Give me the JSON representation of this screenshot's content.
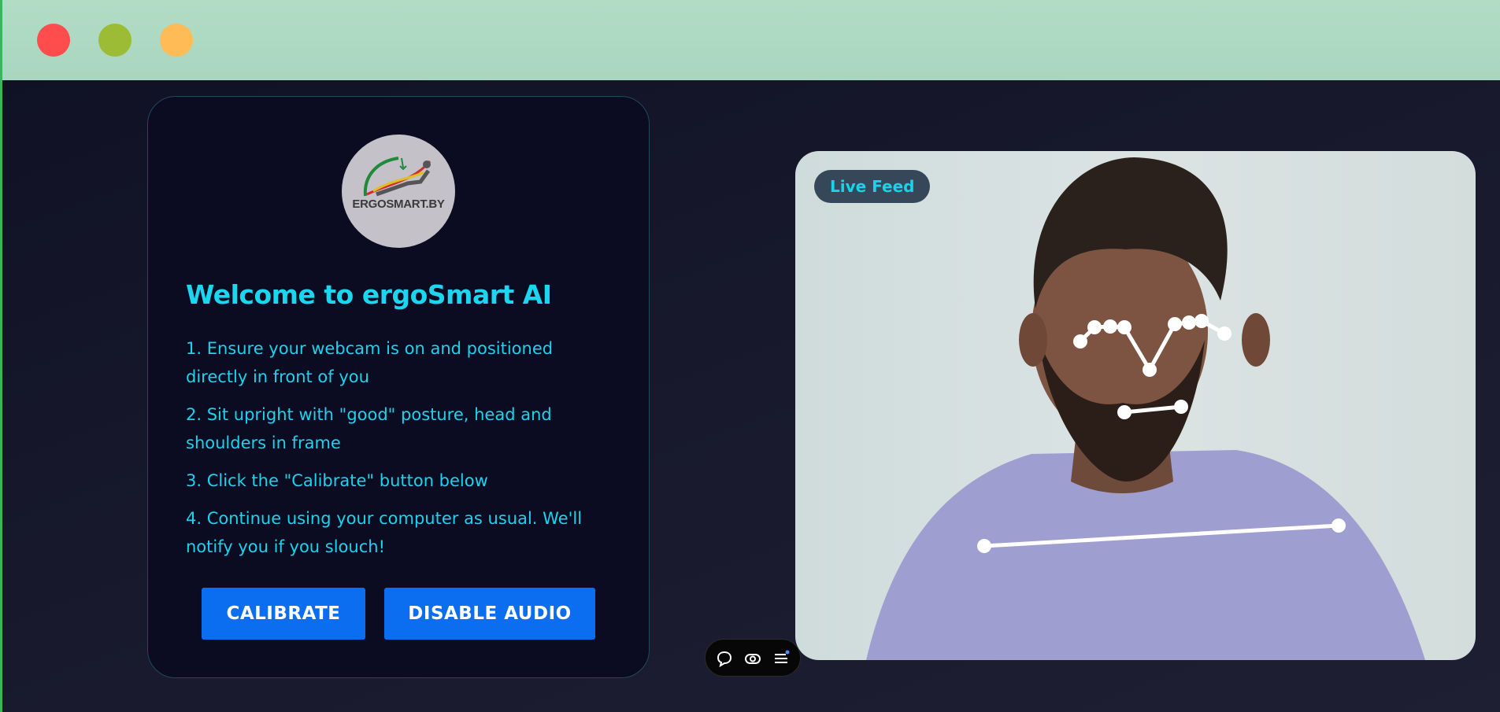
{
  "window": {
    "controls": [
      "close",
      "minimize",
      "maximize"
    ],
    "colors": {
      "close": "#ff4c4c",
      "minimize": "#9cbc35",
      "maximize": "#ffbb55"
    }
  },
  "welcome_card": {
    "logo_text": "ERGOSMART.BY",
    "title": "Welcome to ergoSmart AI",
    "steps": [
      "1. Ensure your webcam is on and positioned directly in front of you",
      "2. Sit upright with \"good\" posture, head and shoulders in frame",
      "3. Click the \"Calibrate\" button below",
      "4. Continue using your computer as usual. We'll notify you if you slouch!"
    ],
    "buttons": {
      "calibrate": "CALIBRATE",
      "disable_audio": "DISABLE AUDIO"
    }
  },
  "feed": {
    "badge": "Live Feed",
    "overlay": "pose-landmarks"
  },
  "toolbar": {
    "icons": [
      "chat-icon",
      "toggle-icon",
      "menu-icon"
    ]
  },
  "colors": {
    "accent": "#1ad6ee",
    "button": "#0b6ef0",
    "card_bg": "#0b0c22",
    "titlebar": "#b2dcc4"
  }
}
